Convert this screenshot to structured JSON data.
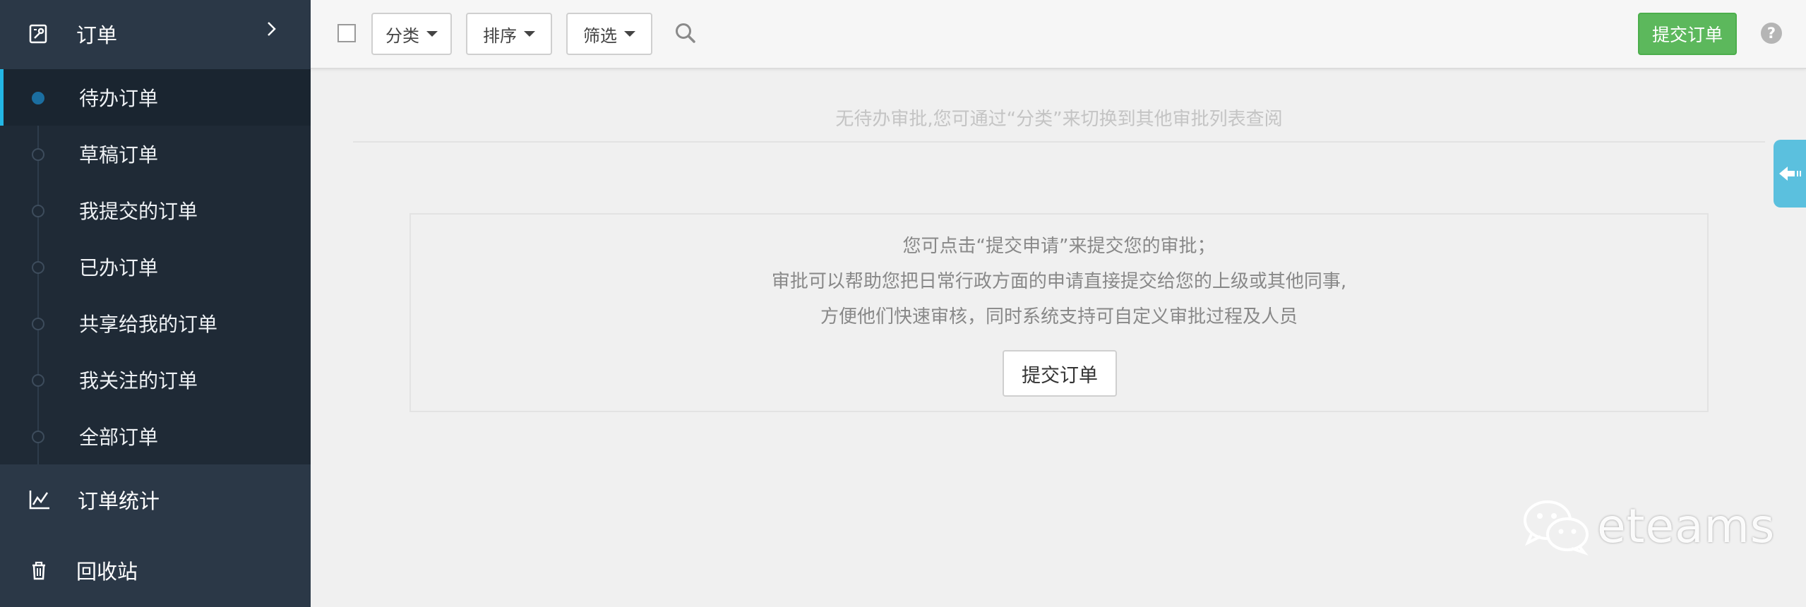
{
  "sidebar": {
    "top": {
      "label": "订单",
      "icon": "order-icon"
    },
    "items": [
      {
        "label": "待办订单",
        "active": true
      },
      {
        "label": "草稿订单"
      },
      {
        "label": "我提交的订单"
      },
      {
        "label": "已办订单"
      },
      {
        "label": "共享给我的订单"
      },
      {
        "label": "我关注的订单"
      },
      {
        "label": "全部订单"
      }
    ],
    "stats": {
      "label": "订单统计",
      "icon": "chart-icon"
    },
    "recycle": {
      "label": "回收站",
      "icon": "trash-icon"
    }
  },
  "toolbar": {
    "category": "分类",
    "sort": "排序",
    "filter": "筛选",
    "submit": "提交订单",
    "help": "?"
  },
  "main": {
    "empty_tip": "无待办审批,您可通过“分类”来切换到其他审批列表查阅",
    "info_lines": [
      "您可点击“提交申请”来提交您的审批；",
      "审批可以帮助您把日常行政方面的申请直接提交给您的上级或其他同事,",
      "方便他们快速审核，同时系统支持可自定义审批过程及人员"
    ],
    "info_button": "提交订单"
  },
  "watermark": {
    "text": "eteams"
  },
  "colors": {
    "sidebar_bg": "#2b3847",
    "submenu_bg": "#1f2a36",
    "active_accent": "#23b7e5",
    "primary_green": "#5cb85c",
    "side_tab": "#5bc0de"
  }
}
